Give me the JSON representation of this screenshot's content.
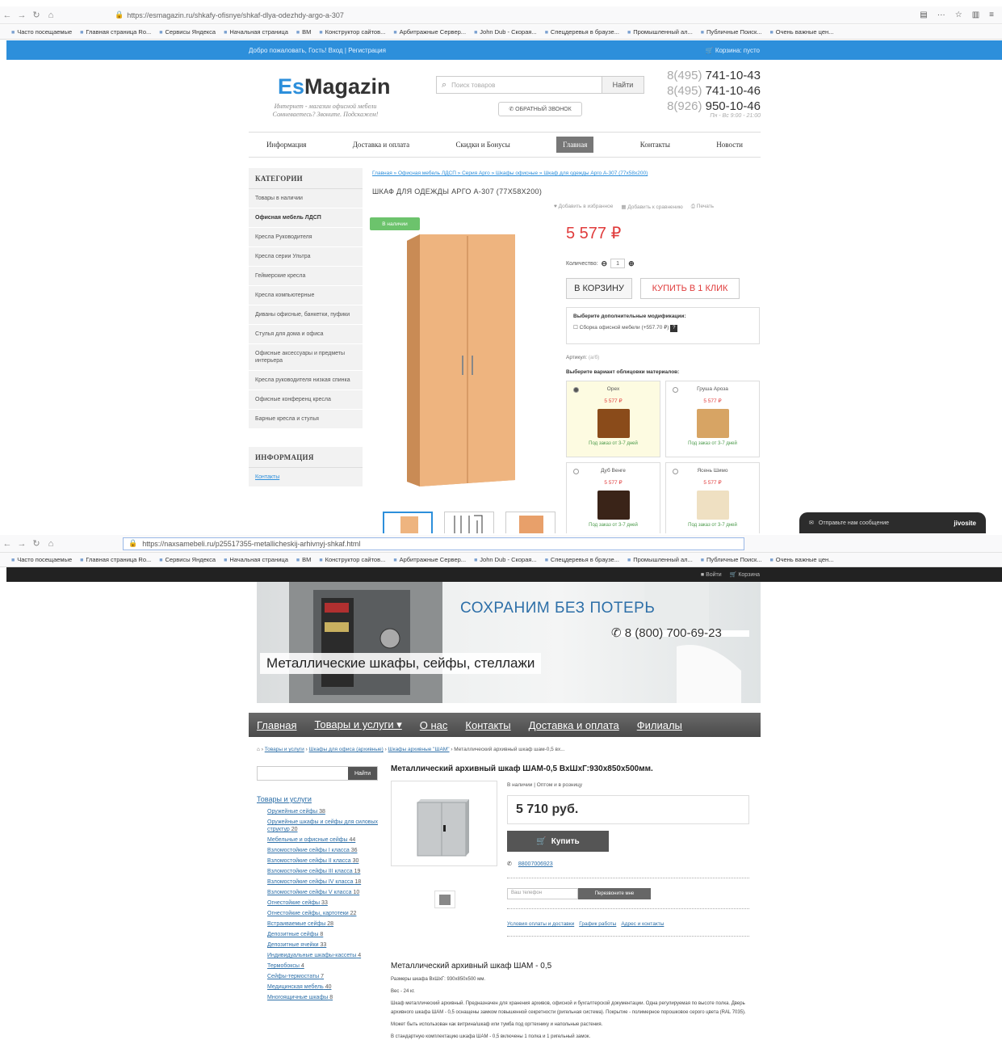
{
  "shot1": {
    "url": "https://esmagazin.ru/shkafy-ofisnye/shkaf-dlya-odezhdy-argo-a-307",
    "bookmarks": [
      "Часто посещаемые",
      "Главная страница Ro...",
      "Сервисы Яндекса",
      "Начальная страница",
      "ВМ",
      "Конструктор сайтов...",
      "Арбитражные Сервер...",
      "John Dub - Скорая...",
      "Спецдеревья в браузе...",
      "Промышленный ал...",
      "Публичные Поиск...",
      "Очень важные цен..."
    ],
    "welcome": "Добро пожаловать, Гость! Вход | Регистрация",
    "cart": "Корзина: пусто",
    "logo_es": "Es",
    "logo_rest": "Magazin",
    "tagline": "Интернет - магазин офисной мебели\nСомневаетесь? Звоните. Подскажем!",
    "search_placeholder": "Поиск товаров",
    "search_button": "Найти",
    "callback": "ОБРАТНЫЙ ЗВОНОК",
    "phones": [
      {
        "code": "8(495)",
        "num": "741-10-43"
      },
      {
        "code": "8(495)",
        "num": "741-10-46"
      },
      {
        "code": "8(926)",
        "num": "950-10-46"
      }
    ],
    "hours": "Пн - Вс 9:00 - 21:00",
    "nav": [
      "Информация",
      "Доставка и оплата",
      "Скидки и Бонусы",
      "Главная",
      "Контакты",
      "Новости"
    ],
    "categories_title": "КАТЕГОРИИ",
    "categories": [
      "Товары в наличии",
      "Офисная мебель ЛДСП",
      "Кресла Руководителя",
      "Кресла серии Ультра",
      "Геймерские кресла",
      "Кресла компьютерные",
      "Диваны офисные, банкетки, пуфики",
      "Стулья для дома и офиса",
      "Офисные аксессуары и предметы интерьера",
      "Кресла руководителя низкая спинка",
      "Офисные конференц кресла",
      "Барные кресла и стулья"
    ],
    "info_title": "ИНФОРМАЦИЯ",
    "info_link": "Контакты",
    "breadcrumb": "Главная » Офисная мебель ЛДСП » Серия Арго » Шкафы офисные » Шкаф для одежды Арго А-307 (77x58x200)",
    "product_title": "ШКАФ ДЛЯ ОДЕЖДЫ АРГО А-307 (77X58X200)",
    "links": [
      "Добавить в избранное",
      "Добавить к сравнению",
      "Печать"
    ],
    "in_stock": "В наличии",
    "price": "5 577 ₽",
    "qty_label": "Количество:",
    "qty_value": "1",
    "btn_cart": "В КОРЗИНУ",
    "btn_oneclick": "КУПИТЬ В 1 КЛИК",
    "mod_title": "Выберите дополнительные модификации:",
    "mod_option": "Сборка офисной мебели (+557.70 ₽)",
    "article_label": "Артикул:",
    "article_value": "(а/б)",
    "choose_title": "Выберите вариант облицовки материалов:",
    "swatches": [
      {
        "name": "Орех",
        "price": "5 577 ₽",
        "delivery": "Под заказ от 3-7 дней",
        "color": "#8a4b1a",
        "selected": true
      },
      {
        "name": "Груша Ароза",
        "price": "5 577 ₽",
        "delivery": "Под заказ от 3-7 дней",
        "color": "#d7a464",
        "selected": false
      },
      {
        "name": "Дуб Венге",
        "price": "5 577 ₽",
        "delivery": "Под заказ от 3-7 дней",
        "color": "#3a2418",
        "selected": false
      },
      {
        "name": "Ясень Шимо",
        "price": "5 577 ₽",
        "delivery": "Под заказ от 3-7 дней",
        "color": "#efe0c2",
        "selected": false
      }
    ],
    "chat_text": "Отправьте нам сообщение",
    "chat_brand": "jivosite"
  },
  "shot2": {
    "url": "https://naxsamebeli.ru/p25517355-metallicheskij-arhivnyj-shkaf.html",
    "topbar": [
      "Войти",
      "Корзина"
    ],
    "hero_title": "СОХРАНИМ БЕЗ ПОТЕРЬ",
    "hero_phone": "8 (800) 700-69-23",
    "hero_tag": "Металлические шкафы, сейфы, стеллажи",
    "nav": [
      "Главная",
      "Товары и услуги ▾",
      "О нас",
      "Контакты",
      "Доставка и оплата",
      "Филиалы"
    ],
    "breadcrumb_links": [
      "Товары и услуги",
      "Шкафы для офиса (архивные)",
      "Шкафы архивные \"ШАМ\""
    ],
    "breadcrumb_tail": "Металлический архивный шкаф шам-0,5 вх...",
    "search_button": "Найти",
    "sidebar_head": "Товары и услуги",
    "sidebar": [
      {
        "t": "Оружейные сейфы",
        "n": "38"
      },
      {
        "t": "Оружейные шкафы и сейфы для силовых структур",
        "n": "20"
      },
      {
        "t": "Мебельные и офисные сейфы",
        "n": "44"
      },
      {
        "t": "Взломостойкие сейфы I класса",
        "n": "36"
      },
      {
        "t": "Взломостойкие сейфы II класса",
        "n": "30"
      },
      {
        "t": "Взломостойкие сейфы III класса",
        "n": "19"
      },
      {
        "t": "Взломостойкие сейфы IV класса",
        "n": "18"
      },
      {
        "t": "Взломостойкие сейфы V класса",
        "n": "10"
      },
      {
        "t": "Огнестойкие сейфы",
        "n": "33"
      },
      {
        "t": "Огнестойкие сейфы, картотеки",
        "n": "22"
      },
      {
        "t": "Встраиваемые сейфы",
        "n": "28"
      },
      {
        "t": "Депозитные сейфы",
        "n": "8"
      },
      {
        "t": "Депозитные ячейки",
        "n": "33"
      },
      {
        "t": "Индивидуальные шкафы-кассеты",
        "n": "4"
      },
      {
        "t": "Термобоксы",
        "n": "4"
      },
      {
        "t": "Сейфы-термостаты",
        "n": "7"
      },
      {
        "t": "Медицинская мебель",
        "n": "40"
      },
      {
        "t": "Многоящичные шкафы",
        "n": "8"
      }
    ],
    "product_title": "Металлический архивный шкаф ШАМ-0,5 ВхШхГ:930х850х500мм.",
    "stock": "В наличии | Оптом и в розницу",
    "price": "5 710 руб.",
    "buy": "Купить",
    "phone": "88007006923",
    "callme_placeholder": "Ваш телефон",
    "callme_button": "Перезвоните мне",
    "links": [
      "Условия оплаты и доставки",
      "График работы",
      "Адрес и контакты"
    ],
    "desc_title": "Металлический архивный шкаф ШАМ - 0,5",
    "desc_lines": [
      "Размеры шкафа ВхШхГ: 930х850х500 мм.",
      "Вес - 24 кг.",
      "Шкаф металлический архивный. Предназначен для хранения архивов, офисной и бухгалтерской документации. Одна регулируемая по высоте полка. Дверь архивного шкафа ШАМ - 0,5 оснащены замком повышенной секретности (ригельная система). Покрытие - полимерное порошковое серого цвета (RAL 7035).",
      "Может быть использован как витрина/шкаф или тумба под оргтехнику и напольные растения.",
      "В стандартную комплектацию шкафа ШАМ - 0,5 включены 1 полка и 1 ригельный замок."
    ]
  }
}
